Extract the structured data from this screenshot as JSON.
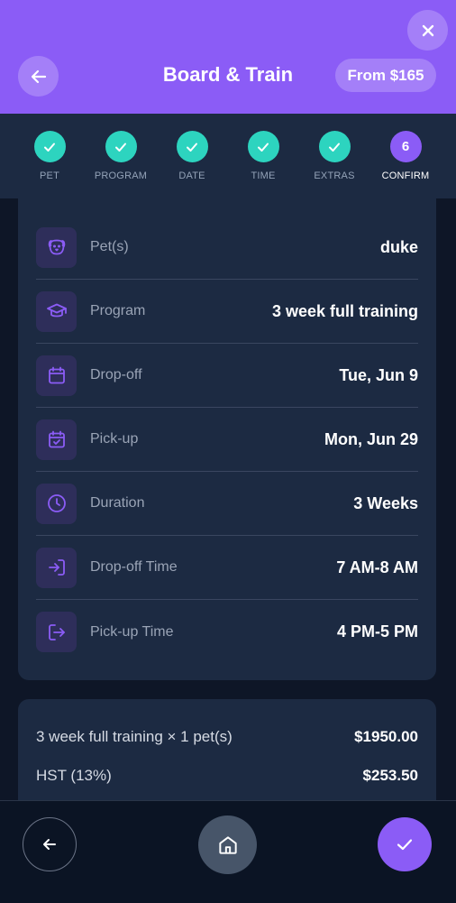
{
  "header": {
    "title": "Board & Train",
    "price": "From $165"
  },
  "steps": [
    {
      "label": "PET",
      "state": "done"
    },
    {
      "label": "PROGRAM",
      "state": "done"
    },
    {
      "label": "DATE",
      "state": "done"
    },
    {
      "label": "TIME",
      "state": "done"
    },
    {
      "label": "EXTRAS",
      "state": "done"
    },
    {
      "label": "CONFIRM",
      "state": "active",
      "number": "6"
    }
  ],
  "summary": [
    {
      "icon": "dog-icon",
      "label": "Pet(s)",
      "value": "duke"
    },
    {
      "icon": "graduation-cap-icon",
      "label": "Program",
      "value": "3 week full training"
    },
    {
      "icon": "calendar-icon",
      "label": "Drop-off",
      "value": "Tue, Jun 9"
    },
    {
      "icon": "calendar-check-icon",
      "label": "Pick-up",
      "value": "Mon, Jun 29"
    },
    {
      "icon": "clock-icon",
      "label": "Duration",
      "value": "3 Weeks"
    },
    {
      "icon": "login-icon",
      "label": "Drop-off Time",
      "value": "7 AM-8 AM"
    },
    {
      "icon": "logout-icon",
      "label": "Pick-up Time",
      "value": "4 PM-5 PM"
    }
  ],
  "pricing": [
    {
      "label": "3 week full training × 1 pet(s)",
      "value": "$1950.00"
    },
    {
      "label": "HST (13%)",
      "value": "$253.50"
    }
  ],
  "colors": {
    "accent": "#8b5cf6",
    "success": "#2dd4bf",
    "background": "#0e1627",
    "card": "#1c2a42"
  }
}
